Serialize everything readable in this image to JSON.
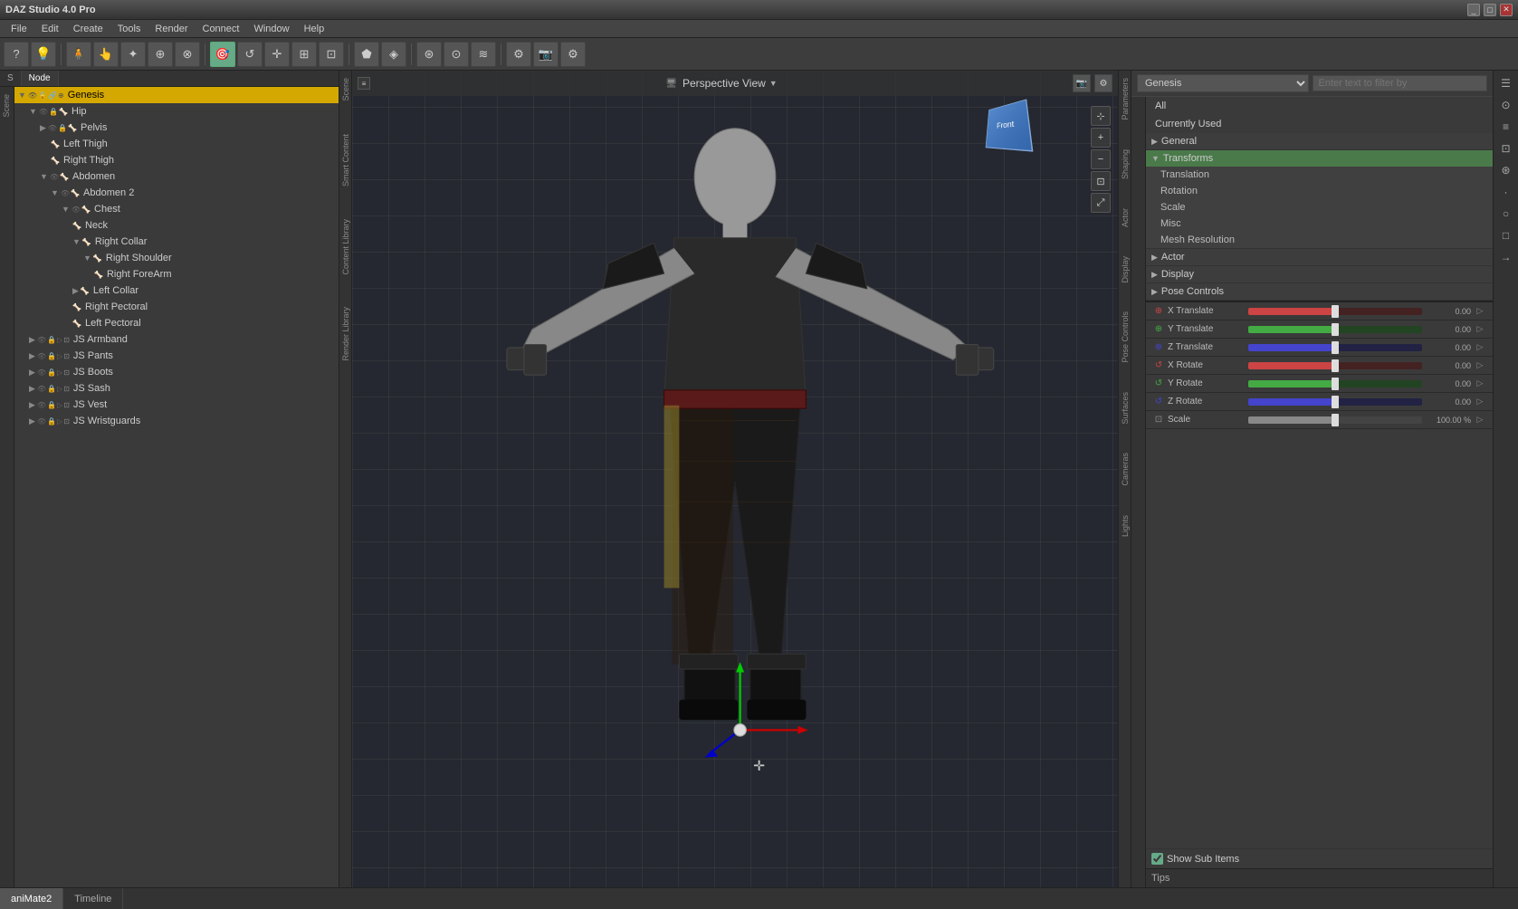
{
  "titlebar": {
    "title": "DAZ Studio 4.0 Pro",
    "win_controls": [
      "_",
      "□",
      "✕"
    ]
  },
  "menubar": {
    "items": [
      "File",
      "Edit",
      "Create",
      "Tools",
      "Render",
      "Connect",
      "Window",
      "Help"
    ]
  },
  "toolbar": {
    "tools": [
      "?",
      "⊙",
      "⊞",
      "✦",
      "⊕",
      "⊗",
      "↺",
      "⊡",
      "▷",
      "✚",
      "⊛",
      "⊘",
      "◈",
      "⊕",
      "⊡",
      "⊞",
      "⊛",
      "⊙",
      "⊡",
      "⊡",
      "⊙",
      "⊡"
    ]
  },
  "left_panel": {
    "tabs": [
      "S",
      "N"
    ],
    "node_header": "Node",
    "tree": [
      {
        "id": "genesis",
        "label": "Genesis",
        "indent": 0,
        "selected": true,
        "has_eye": true,
        "has_lock": true,
        "has_link": true,
        "expanded": true
      },
      {
        "id": "hip",
        "label": "Hip",
        "indent": 1,
        "selected": false,
        "has_eye": true,
        "has_lock": true,
        "expanded": true
      },
      {
        "id": "pelvis",
        "label": "Pelvis",
        "indent": 2,
        "selected": false,
        "has_eye": true,
        "has_lock": true,
        "expanded": false
      },
      {
        "id": "left-thigh",
        "label": "Left Thigh",
        "indent": 3,
        "selected": false
      },
      {
        "id": "right-thigh",
        "label": "Right Thigh",
        "indent": 3,
        "selected": false
      },
      {
        "id": "abdomen",
        "label": "Abdomen",
        "indent": 2,
        "selected": false,
        "expanded": true
      },
      {
        "id": "abdomen2",
        "label": "Abdomen 2",
        "indent": 3,
        "selected": false,
        "expanded": true
      },
      {
        "id": "chest",
        "label": "Chest",
        "indent": 4,
        "selected": false,
        "expanded": true
      },
      {
        "id": "neck",
        "label": "Neck",
        "indent": 5,
        "selected": false
      },
      {
        "id": "right-collar",
        "label": "Right Collar",
        "indent": 5,
        "selected": false,
        "expanded": true
      },
      {
        "id": "right-shoulder",
        "label": "Right Shoulder",
        "indent": 6,
        "selected": false,
        "expanded": true
      },
      {
        "id": "right-forearm",
        "label": "Right ForeArm",
        "indent": 7,
        "selected": false
      },
      {
        "id": "left-collar",
        "label": "Left Collar",
        "indent": 5,
        "selected": false,
        "expanded": false
      },
      {
        "id": "right-pectoral",
        "label": "Right Pectoral",
        "indent": 5,
        "selected": false
      },
      {
        "id": "left-pectoral",
        "label": "Left Pectoral",
        "indent": 5,
        "selected": false
      },
      {
        "id": "js-armband",
        "label": "JS Armband",
        "indent": 1,
        "selected": false,
        "is_prop": true
      },
      {
        "id": "js-pants",
        "label": "JS Pants",
        "indent": 1,
        "selected": false,
        "is_prop": true
      },
      {
        "id": "js-boots",
        "label": "JS Boots",
        "indent": 1,
        "selected": false,
        "is_prop": true
      },
      {
        "id": "js-sash",
        "label": "JS Sash",
        "indent": 1,
        "selected": false,
        "is_prop": true
      },
      {
        "id": "js-vest",
        "label": "JS Vest",
        "indent": 1,
        "selected": false,
        "is_prop": true
      },
      {
        "id": "js-wristguards",
        "label": "JS Wristguards",
        "indent": 1,
        "selected": false,
        "is_prop": true
      }
    ]
  },
  "viewport": {
    "perspective_label": "Perspective View",
    "cube_label": "Front"
  },
  "vtabs_left": [
    "Scene",
    "Smart Content",
    "Content Library",
    "Render Library"
  ],
  "vtabs_right": [
    "Parameters",
    "Shaping",
    "Actor",
    "Display",
    "Pose Controls",
    "Surfaces",
    "Cameras",
    "Lights"
  ],
  "right_panel": {
    "genesis_select": "Genesis",
    "filter_placeholder": "Enter text to filter by",
    "sections": {
      "all_label": "All",
      "currently_used_label": "Currently Used",
      "general_label": "General",
      "transforms_label": "Transforms",
      "transforms_expanded": true,
      "transform_items": [
        "Translation",
        "Rotation",
        "Scale",
        "Misc",
        "Mesh Resolution"
      ],
      "actor_label": "Actor",
      "display_label": "Display",
      "pose_controls_label": "Pose Controls"
    },
    "sliders": {
      "x_translate": {
        "label": "X Translate",
        "value": "0.00",
        "fill_pct": 50
      },
      "y_translate": {
        "label": "Y Translate",
        "value": "0.00",
        "fill_pct": 50
      },
      "z_translate": {
        "label": "Z Translate",
        "value": "0.00",
        "fill_pct": 50
      },
      "x_rotate": {
        "label": "X Rotate",
        "value": "0.00",
        "fill_pct": 50
      },
      "y_rotate": {
        "label": "Y Rotate",
        "value": "0.00",
        "fill_pct": 50
      },
      "z_rotate": {
        "label": "Z Rotate",
        "value": "0.00",
        "fill_pct": 50
      },
      "scale": {
        "label": "Scale",
        "value": "100.00 %",
        "fill_pct": 50
      }
    },
    "show_sub_items": true,
    "show_sub_items_label": "Show Sub Items",
    "tips_label": "Tips"
  },
  "bottom_tabs": [
    {
      "label": "aniMate2",
      "active": true
    },
    {
      "label": "Timeline",
      "active": false
    }
  ],
  "right_icons": [
    "☰",
    "⊙",
    "≡",
    "⊡",
    "⊙",
    "⊡",
    "⊙",
    "⊡",
    "⊙"
  ]
}
